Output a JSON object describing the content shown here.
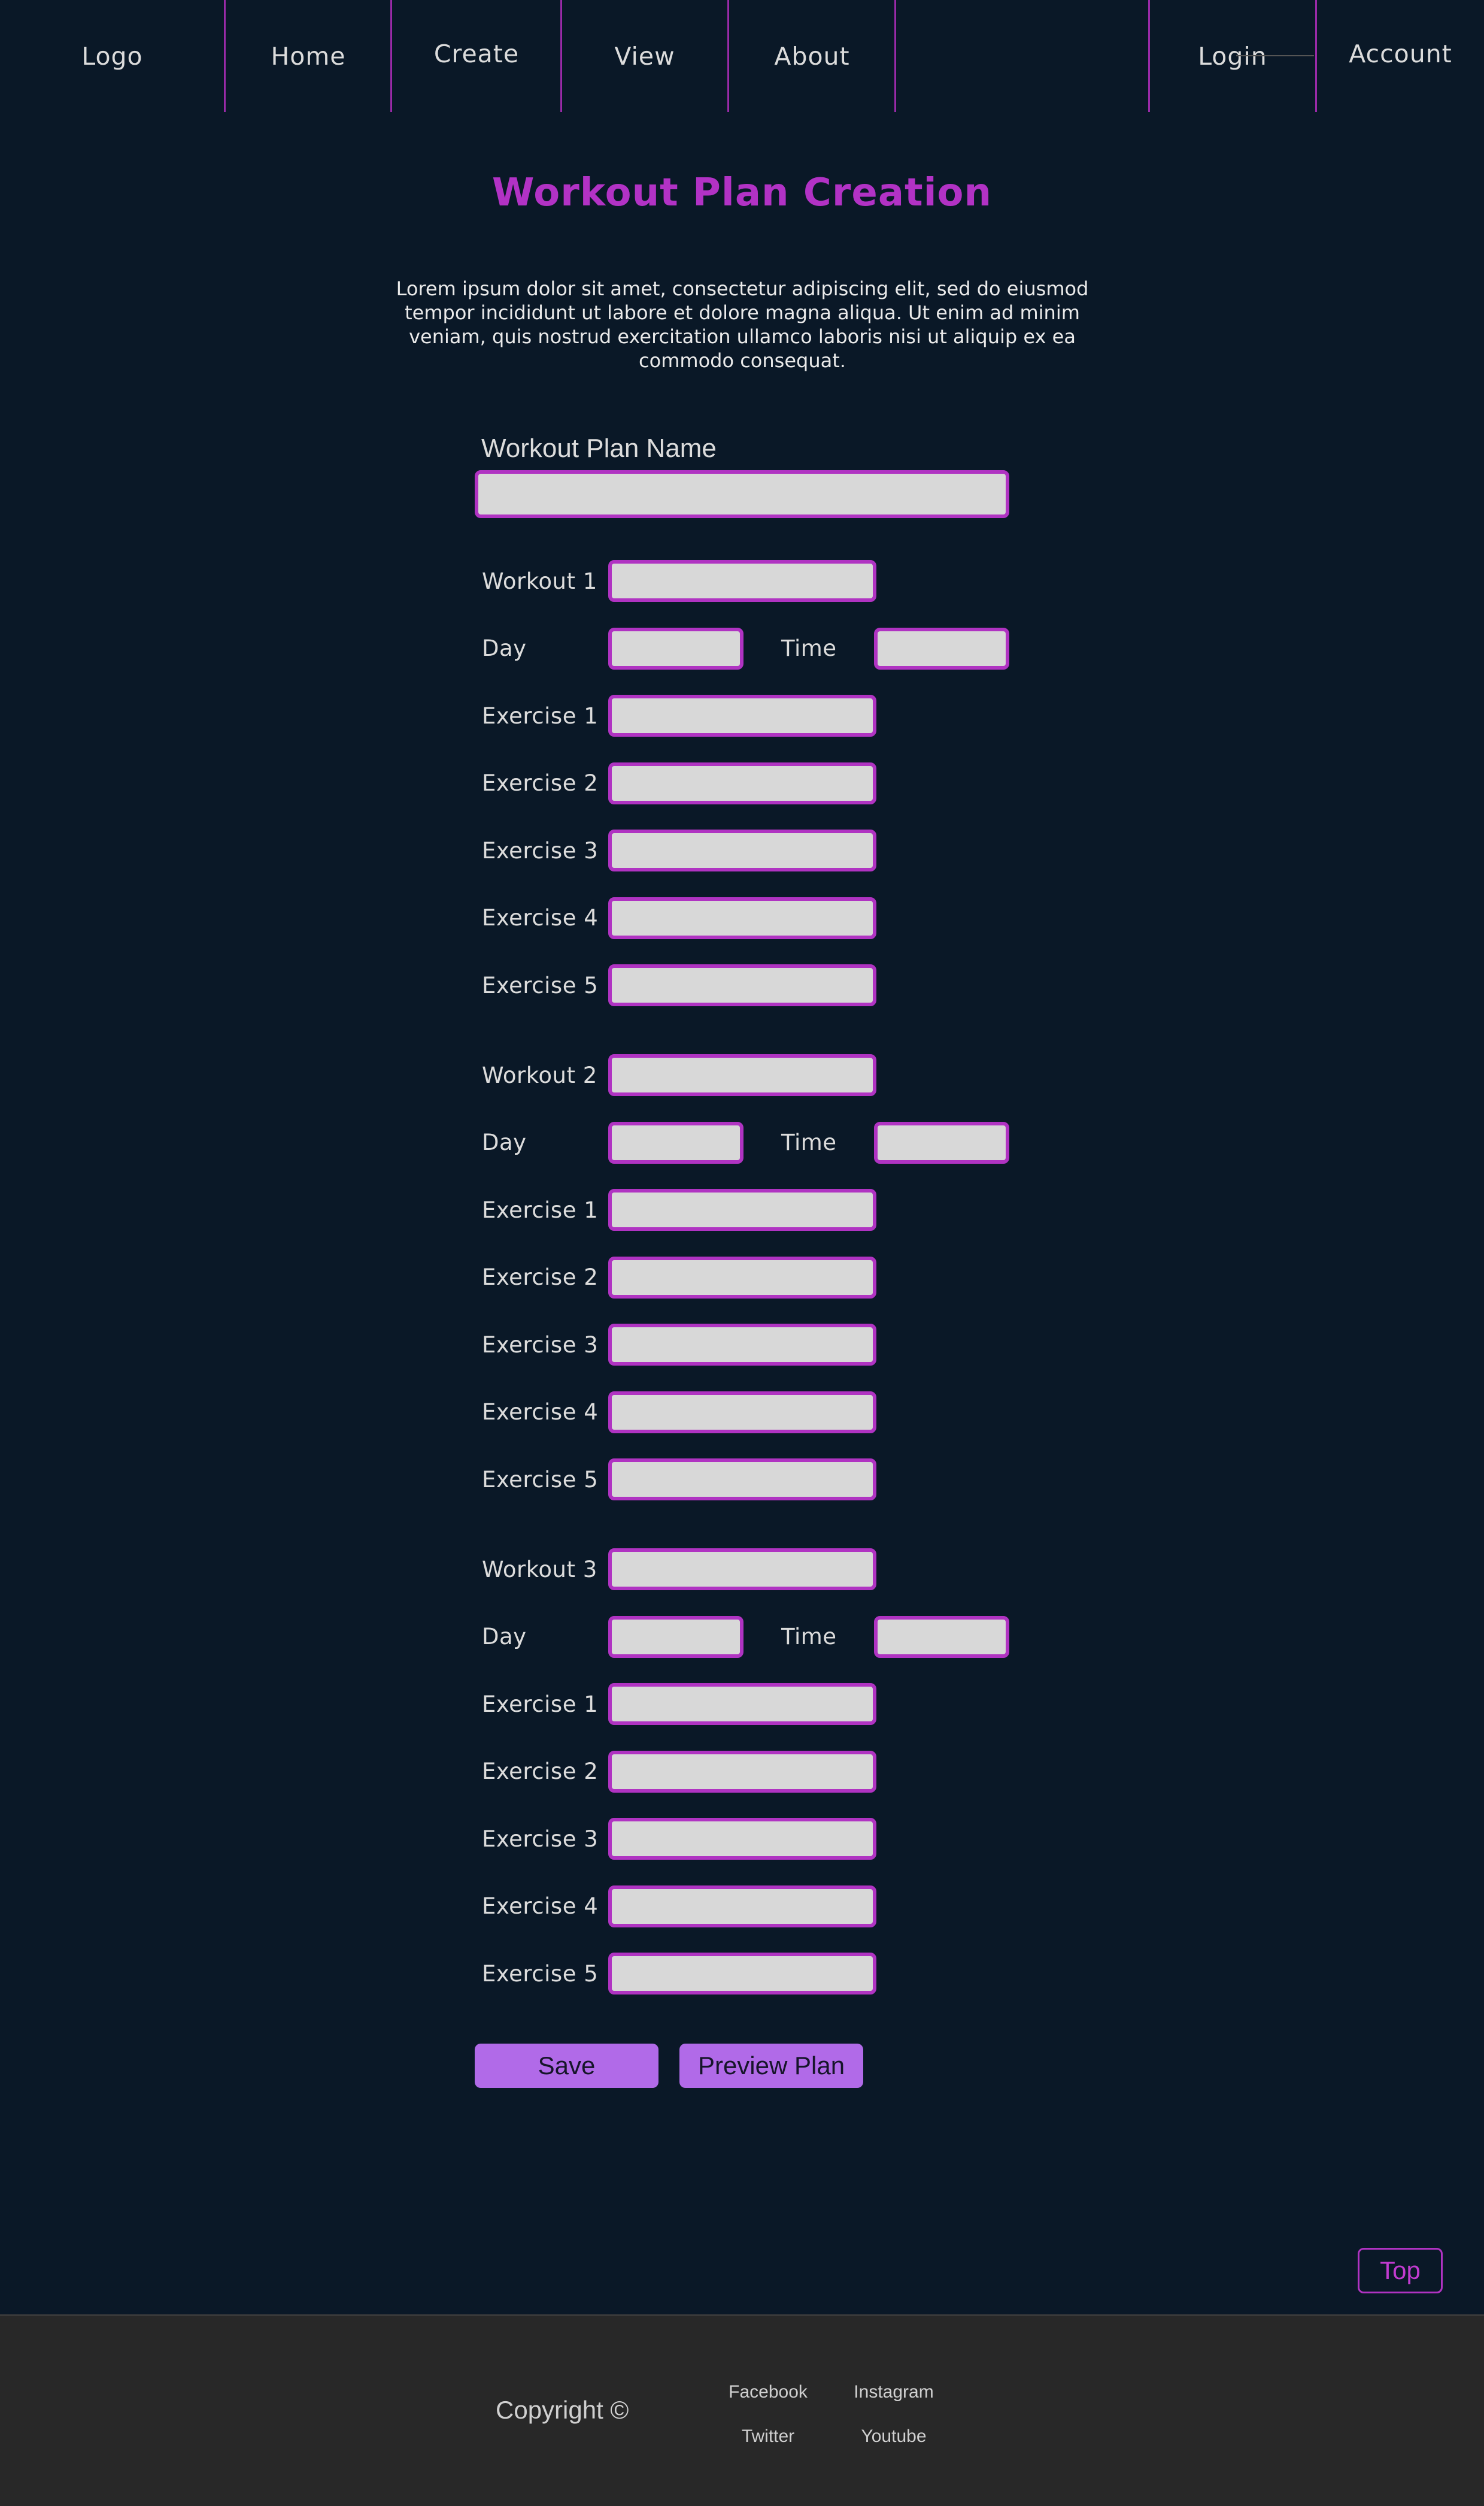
{
  "nav": {
    "logo": "Logo",
    "home": "Home",
    "create": "Create",
    "view": "View",
    "about": "About",
    "login": "Login",
    "account": "Account"
  },
  "page": {
    "title": "Workout Plan Creation",
    "intro": "Lorem ipsum dolor sit amet, consectetur adipiscing elit, sed do eiusmod  tempor incididunt ut labore et dolore magna aliqua. Ut enim ad minim  veniam, quis nostrud exercitation ullamco laboris nisi ut aliquip ex ea  commodo consequat.",
    "plan_name_label": "Workout Plan Name",
    "plan_name_value": ""
  },
  "labels": {
    "day": "Day",
    "time": "Time",
    "exercises": [
      "Exercise 1",
      "Exercise 2",
      "Exercise 3",
      "Exercise 4",
      "Exercise 5"
    ]
  },
  "workouts": [
    {
      "label": "Workout 1",
      "name": "",
      "day": "",
      "time": "",
      "exercises": [
        "",
        "",
        "",
        "",
        ""
      ]
    },
    {
      "label": "Workout 2",
      "name": "",
      "day": "",
      "time": "",
      "exercises": [
        "",
        "",
        "",
        "",
        ""
      ]
    },
    {
      "label": "Workout 3",
      "name": "",
      "day": "",
      "time": "",
      "exercises": [
        "",
        "",
        "",
        "",
        ""
      ]
    }
  ],
  "actions": {
    "save": "Save",
    "preview": "Preview Plan",
    "top": "Top"
  },
  "footer": {
    "copyright": "Copyright ©",
    "facebook": "Facebook",
    "instagram": "Instagram",
    "twitter": "Twitter",
    "youtube": "Youtube"
  },
  "colors": {
    "background": "#0a1827",
    "accent": "#b232c5",
    "button": "#b16ae8",
    "field": "#d8d8d8",
    "footer": "#282828"
  }
}
